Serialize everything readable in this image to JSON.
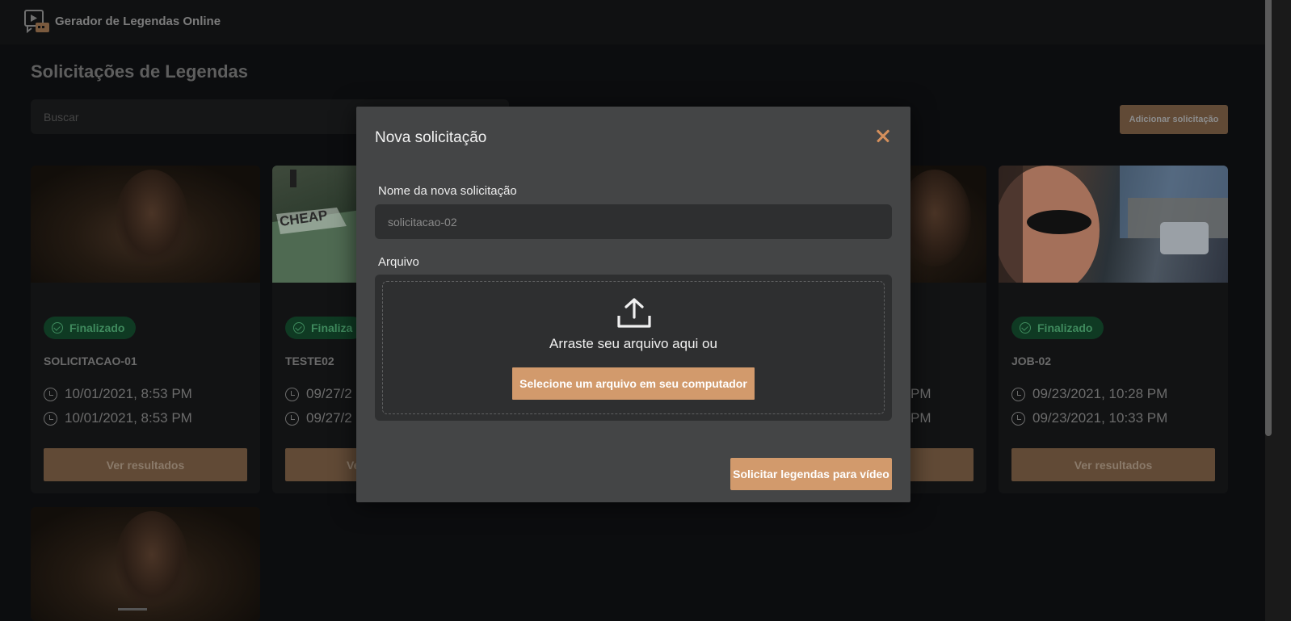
{
  "app": {
    "title": "Gerador de Legendas Online"
  },
  "page": {
    "title": "Solicitações de Legendas",
    "search_placeholder": "Buscar",
    "add_button": "Adicionar solicitação"
  },
  "cards": [
    {
      "status": "Finalizado",
      "name": "SOLICITACAO-01",
      "created": "10/01/2021, 8:53 PM",
      "finished": "10/01/2021, 8:53 PM",
      "button": "Ver resultados"
    },
    {
      "status": "Finaliza",
      "name": "TESTE02",
      "created": "09/27/2",
      "finished": "09/27/2",
      "button": "Ve"
    },
    {
      "created_tail": "PM",
      "finished_tail": "PM"
    },
    {
      "status": "Finalizado",
      "name": "JOB-02",
      "created": "09/23/2021, 10:28 PM",
      "finished": "09/23/2021, 10:33 PM",
      "button": "Ver resultados"
    }
  ],
  "modal": {
    "title": "Nova solicitação",
    "name_label": "Nome da nova solicitação",
    "name_placeholder": "solicitacao-02",
    "file_label": "Arquivo",
    "drop_text": "Arraste seu arquivo aqui ou",
    "select_button": "Selecione um arquivo em seu computador",
    "submit_button": "Solicitar legendas para vídeo"
  },
  "colors": {
    "accent": "#d29a6c",
    "accent_dim": "#614a36",
    "status_green": "#3f8a5d",
    "modal_bg": "#444546",
    "close_icon": "#d48f5c"
  }
}
